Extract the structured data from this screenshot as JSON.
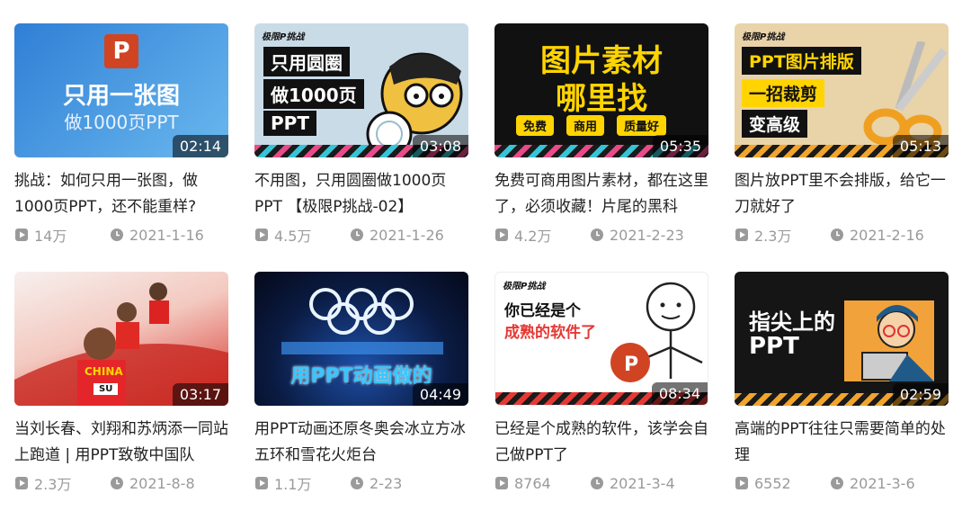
{
  "videos": [
    {
      "title": "挑战：如何只用一张图，做1000页PPT，还不能重样?",
      "views": "14万",
      "date": "2021-1-16",
      "duration": "02:14",
      "thumb": {
        "brand": "",
        "line1": "只用一张图",
        "line2": "做1000页PPT",
        "icon": "P"
      }
    },
    {
      "title": "不用图，只用圆圈做1000页PPT 【极限P挑战-02】",
      "views": "4.5万",
      "date": "2021-1-26",
      "duration": "03:08",
      "thumb": {
        "brand": "极限P挑战",
        "line1": "只用圆圈",
        "line2": "做1000页",
        "line3": "PPT"
      }
    },
    {
      "title": "免费可商用图片素材，都在这里了，必须收藏！片尾的黑科",
      "views": "4.2万",
      "date": "2021-2-23",
      "duration": "05:35",
      "thumb": {
        "line1": "图片素材",
        "line2": "哪里找",
        "tags": [
          "免费",
          "商用",
          "质量好"
        ]
      }
    },
    {
      "title": "图片放PPT里不会排版，给它一刀就好了",
      "views": "2.3万",
      "date": "2021-2-16",
      "duration": "05:13",
      "thumb": {
        "brand": "极限P挑战",
        "line1": "PPT图片排版",
        "line2": "一招裁剪",
        "line3": "变高级"
      }
    },
    {
      "title": "当刘长春、刘翔和苏炳添一同站上跑道 | 用PPT致敬中国队",
      "views": "2.3万",
      "date": "2021-8-8",
      "duration": "03:17",
      "thumb": {
        "shirt": "CHINA",
        "bib": "SU"
      }
    },
    {
      "title": "用PPT动画还原冬奥会冰立方冰五环和雪花火炬台",
      "views": "1.1万",
      "date": "2-23",
      "duration": "04:49",
      "thumb": {
        "line1": "用PPT动画做的"
      }
    },
    {
      "title": "已经是个成熟的软件，该学会自己做PPT了",
      "views": "8764",
      "date": "2021-3-4",
      "duration": "08:34",
      "thumb": {
        "brand": "极限P挑战",
        "line1": "你已经是个",
        "line2": "成熟的软件了"
      }
    },
    {
      "title": "高端的PPT往往只需要简单的处理",
      "views": "6552",
      "date": "2021-3-6",
      "duration": "02:59",
      "thumb": {
        "line1": "指尖上的",
        "line2": "PPT"
      }
    }
  ],
  "icons": {
    "views": "play-square-icon",
    "date": "clock-icon"
  },
  "colors": {
    "meta": "#9a9a9a",
    "title": "#222222",
    "ppt_orange": "#d04423"
  }
}
